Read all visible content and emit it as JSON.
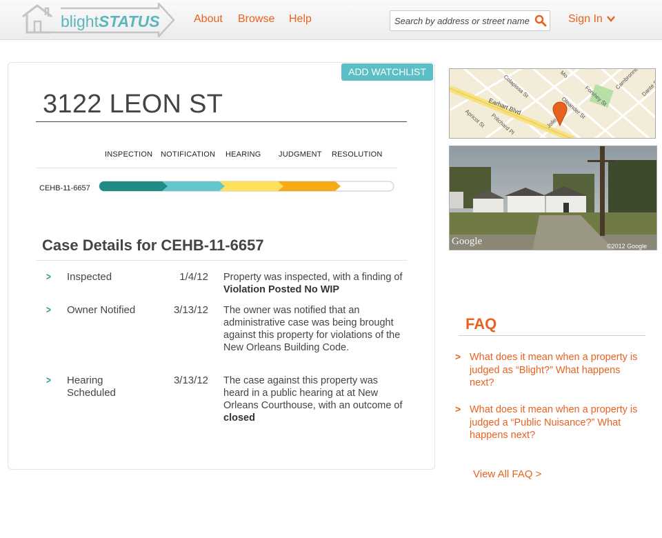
{
  "header": {
    "logo_part1": "blight",
    "logo_part2": "STATUS",
    "nav": [
      "About",
      "Browse",
      "Help"
    ],
    "search_placeholder": "Search by address or street name",
    "signin_label": "Sign In",
    "accent_color": "#e8621f",
    "brand_color": "#5bb6bd"
  },
  "property": {
    "watchlist_label": "ADD WATCHLIST",
    "address": "3122 LEON ST"
  },
  "progress": {
    "stages": [
      "INSPECTION",
      "NOTIFICATION",
      "HEARING",
      "JUDGMENT",
      "RESOLUTION"
    ],
    "case_id": "CEHB-11-6657",
    "segment_colors": [
      "#1f8c86",
      "#63c7cd",
      "#fde15c",
      "#f6aa17",
      "#ffffff"
    ]
  },
  "details": {
    "title": "Case Details for CEHB-11-6657",
    "events": [
      {
        "name": "Inspected",
        "date": "1/4/12",
        "desc": "Property was inspected, with a finding of ",
        "desc_bold": "Violation Posted No WIP"
      },
      {
        "name": "Owner Notified",
        "date": "3/13/12",
        "desc": "The owner was notified that an administrative case was being brought against this property for violations of the New Orleans Building Code.",
        "desc_bold": ""
      },
      {
        "name": "Hearing Scheduled",
        "date": "3/13/12",
        "desc": "The case against this property was heard in a public hearing at at New Orleans Courthouse, with an outcome of ",
        "desc_bold": "closed"
      }
    ]
  },
  "map": {
    "streets": [
      "Colapissa St",
      "Earhart Blvd",
      "Pritchard Pl",
      "Apricot St",
      "Jolie",
      "Oleander St",
      "Forshey St",
      "Cambronne",
      "Dante St",
      "Mo"
    ]
  },
  "streetview": {
    "brand": "Google",
    "copyright": "©2012 Google"
  },
  "faq": {
    "title": "FAQ",
    "items": [
      "What does it mean when a property is judged as “Blight?” What happens next?",
      "What does it mean when a property is judged a “Public Nuisance?” What happens next?"
    ],
    "view_all": "View All FAQ >"
  },
  "icons": [
    "house-logo-icon",
    "search-icon",
    "chevron-down-icon",
    "chevron-right-icon",
    "map-pin-icon"
  ]
}
